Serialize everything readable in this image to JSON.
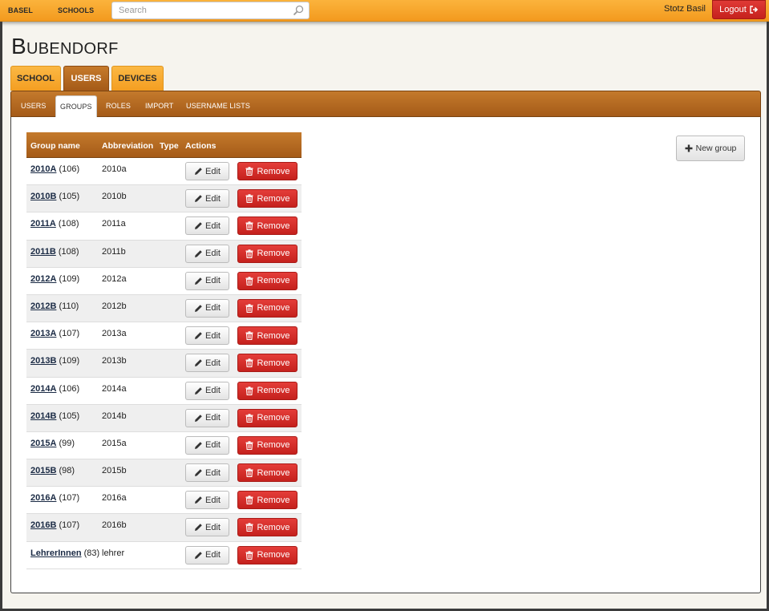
{
  "topnav": {
    "item1": "BASEL",
    "item2": "SCHOOLS"
  },
  "search": {
    "placeholder": "Search"
  },
  "user": {
    "name": "Stotz Basil",
    "logout_label": "Logout"
  },
  "page_title": "Bubendorf",
  "main_tabs": [
    "SCHOOL",
    "USERS",
    "DEVICES"
  ],
  "sub_tabs": [
    "USERS",
    "GROUPS",
    "ROLES",
    "IMPORT",
    "USERNAME LISTS"
  ],
  "table": {
    "headers": {
      "name": "Group name",
      "abbr": "Abbreviation",
      "type": "Type",
      "actions": "Actions"
    },
    "edit_label": "Edit",
    "remove_label": "Remove",
    "rows": [
      {
        "name": "2010A",
        "count": "(106)",
        "abbr": "2010a"
      },
      {
        "name": "2010B",
        "count": "(105)",
        "abbr": "2010b"
      },
      {
        "name": "2011A",
        "count": "(108)",
        "abbr": "2011a"
      },
      {
        "name": "2011B",
        "count": "(108)",
        "abbr": "2011b"
      },
      {
        "name": "2012A",
        "count": "(109)",
        "abbr": "2012a"
      },
      {
        "name": "2012B",
        "count": "(110)",
        "abbr": "2012b"
      },
      {
        "name": "2013A",
        "count": "(107)",
        "abbr": "2013a"
      },
      {
        "name": "2013B",
        "count": "(109)",
        "abbr": "2013b"
      },
      {
        "name": "2014A",
        "count": "(106)",
        "abbr": "2014a"
      },
      {
        "name": "2014B",
        "count": "(105)",
        "abbr": "2014b"
      },
      {
        "name": "2015A",
        "count": "(99)",
        "abbr": "2015a"
      },
      {
        "name": "2015B",
        "count": "(98)",
        "abbr": "2015b"
      },
      {
        "name": "2016A",
        "count": "(107)",
        "abbr": "2016a"
      },
      {
        "name": "2016B",
        "count": "(107)",
        "abbr": "2016b"
      },
      {
        "name": "LehrerInnen",
        "count": "(83)",
        "abbr": "lehrer"
      }
    ]
  },
  "new_group_label": "New group",
  "icons": {
    "search": "search-icon",
    "logout": "sign-out-icon",
    "edit": "pencil-icon",
    "remove": "trash-icon",
    "add": "plus-icon"
  },
  "colors": {
    "topbar": "#f39a1e",
    "accent_brown": "#a55b18",
    "danger": "#c5211d"
  }
}
